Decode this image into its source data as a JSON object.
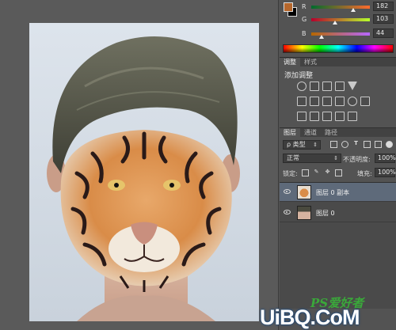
{
  "color_panel": {
    "fg_color": "#b6672c",
    "bg_color": "#000000",
    "channels": [
      {
        "label": "R",
        "value": "182",
        "thumb": 0.71,
        "grad": "linear-gradient(90deg,#006b2c,#ff6b2c)"
      },
      {
        "label": "G",
        "value": "103",
        "thumb": 0.4,
        "grad": "linear-gradient(90deg,#b6002c,#b6ff2c)"
      },
      {
        "label": "B",
        "value": "44",
        "thumb": 0.17,
        "grad": "linear-gradient(90deg,#b66700,#b667ff)"
      }
    ]
  },
  "adjustments": {
    "tabs": [
      "调整",
      "样式"
    ],
    "title": "添加调整",
    "row1": [
      "brightness-icon",
      "curves-icon",
      "levels-icon",
      "exposure-icon",
      "triangle-icon"
    ],
    "row2": [
      "vibrance-icon",
      "balance-icon",
      "photo-filter-icon",
      "bw-icon",
      "channel-mixer-icon",
      "color-lookup-icon"
    ],
    "row3": [
      "invert-icon",
      "posterize-icon",
      "threshold-icon",
      "gradient-map-icon",
      "selective-color-icon"
    ]
  },
  "layers": {
    "tabs": [
      "图层",
      "通道",
      "路径"
    ],
    "filter_label": "ρ 类型",
    "blend_mode": "正常",
    "opacity_label": "不透明度:",
    "opacity_value": "100%",
    "lock_label": "锁定:",
    "fill_label": "填充:",
    "fill_value": "100%",
    "items": [
      {
        "name": "图层 0 副本",
        "selected": true,
        "thumb": "tiger-thumb"
      },
      {
        "name": "图层 0",
        "selected": false,
        "thumb": "face-thumb"
      }
    ]
  },
  "watermark": {
    "top": "PS爱好者",
    "main": "UiBQ.CoM"
  }
}
